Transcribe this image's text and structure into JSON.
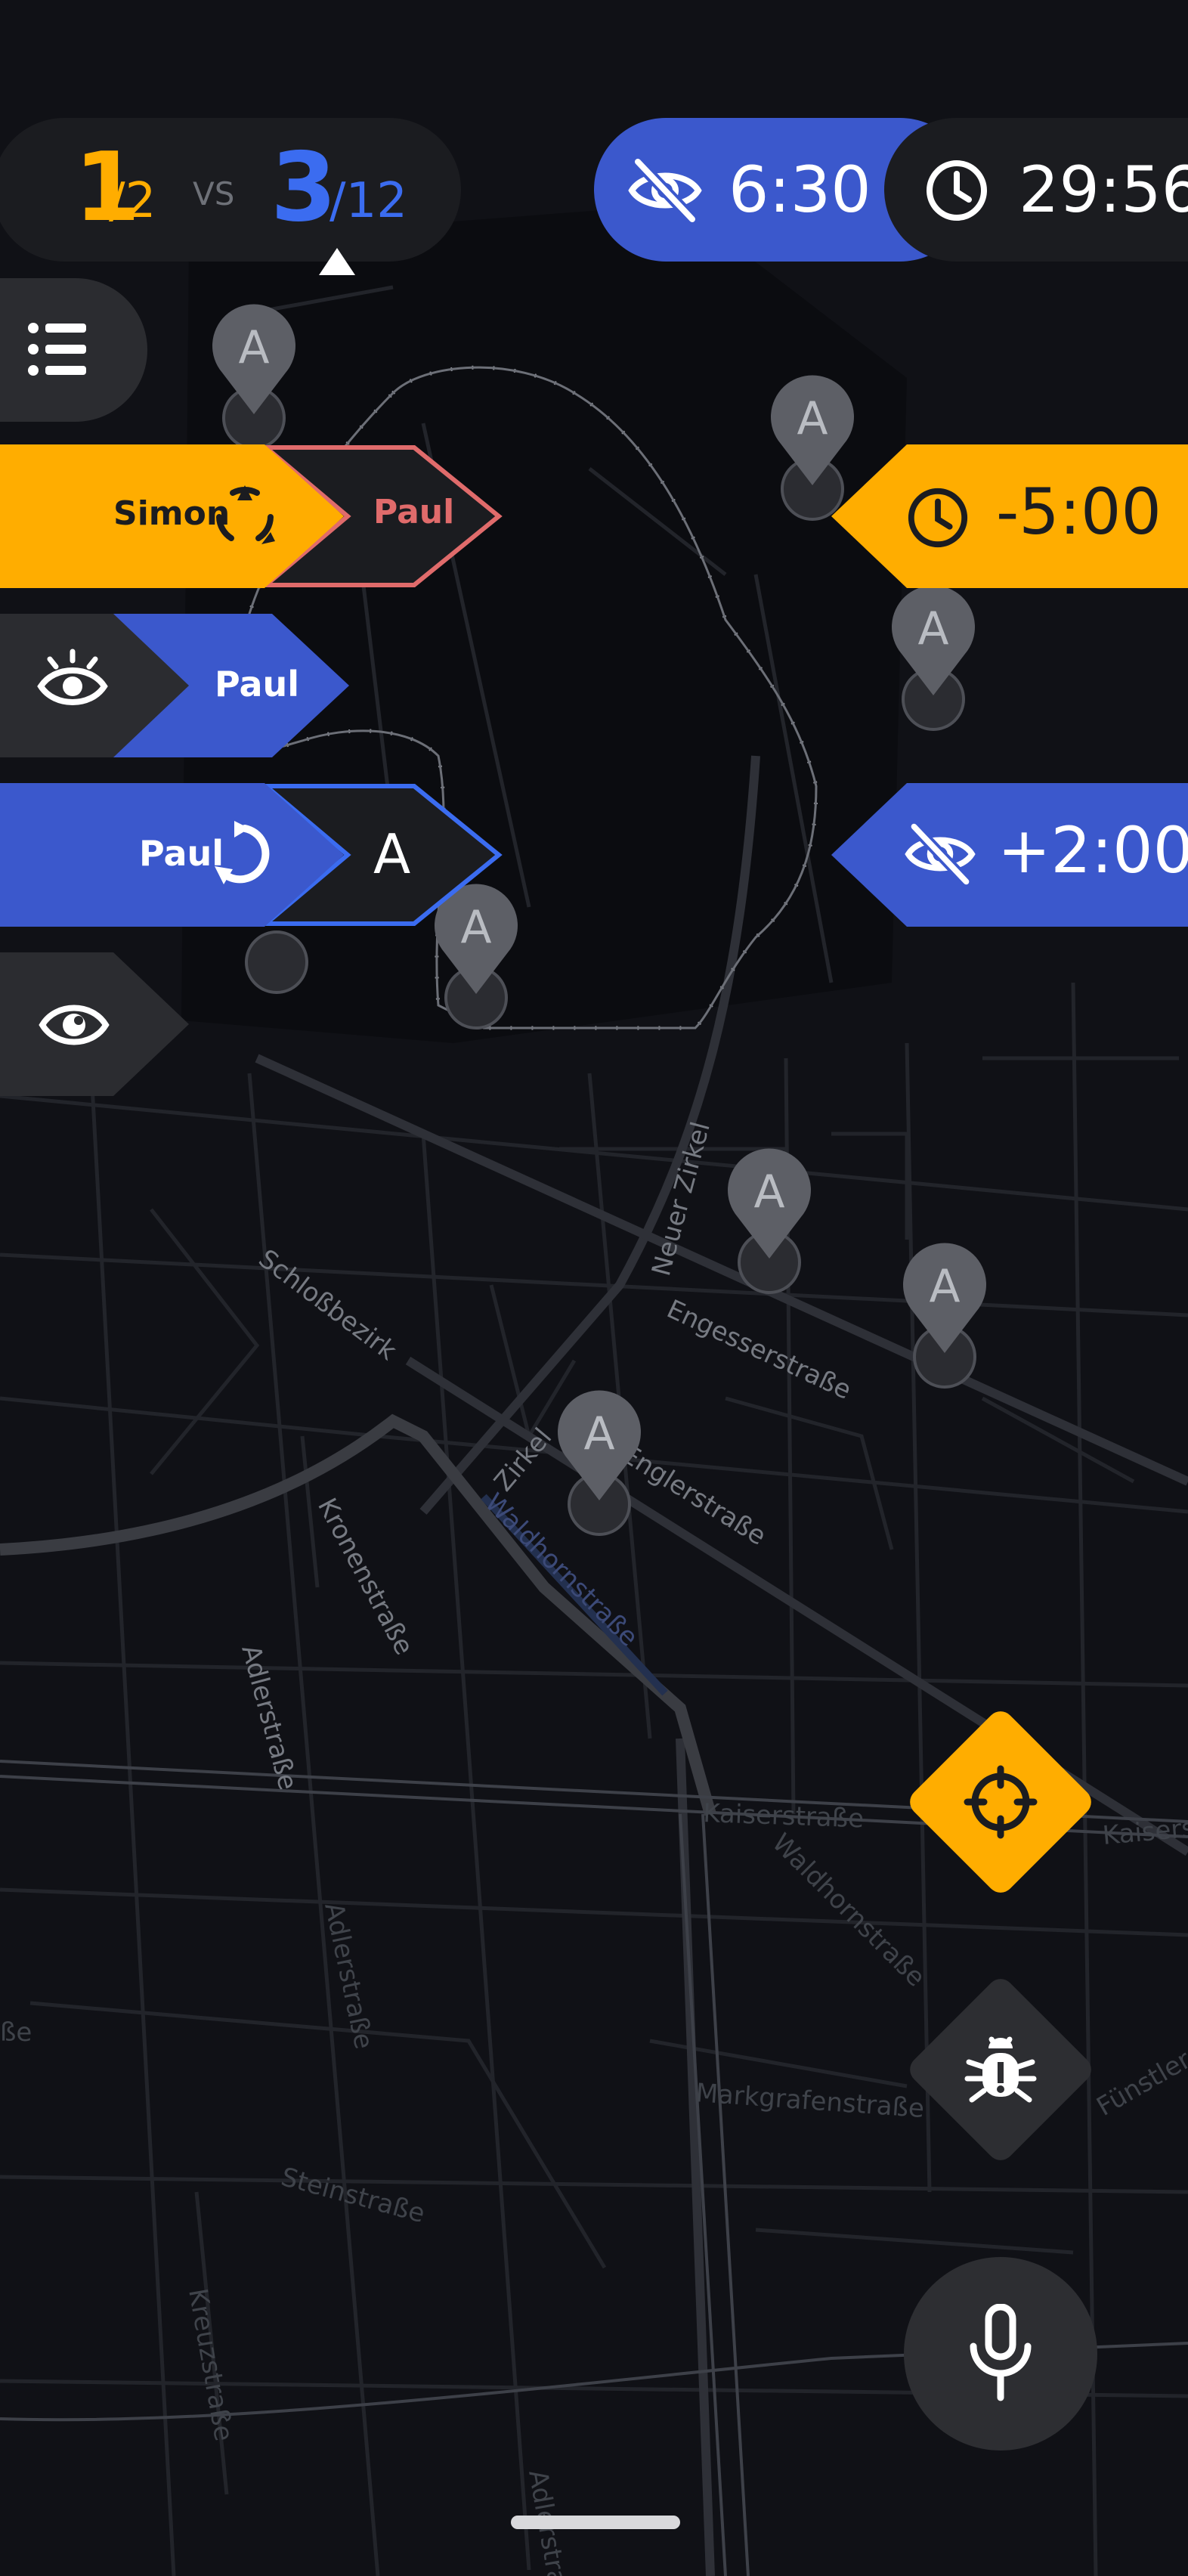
{
  "score": {
    "own_count": "1",
    "own_total": "/2",
    "vs": "VS",
    "enemy_count": "3",
    "enemy_total": "/12"
  },
  "timers": {
    "hidden_time": "6:30",
    "game_time": "29:56"
  },
  "events": {
    "catch_banner": {
      "actor": "Simon",
      "target": "Paul"
    },
    "reveal_banner": {
      "target": "Paul"
    },
    "capture_banner": {
      "actor": "Paul",
      "point": "A"
    },
    "time_penalty": "-5:00",
    "hidden_bonus": "+2:00"
  },
  "map": {
    "streets": [
      "Schloßbezirk",
      "Neuer Zirkel",
      "Engesserstraße",
      "Zirkel",
      "Englerstraße",
      "Waldhornstraße",
      "Kronenstraße",
      "Adlerstraße",
      "Adlerstraße",
      "Kaiserstraße",
      "Waldhornstraße",
      "Markgrafenstraße",
      "Steinstraße",
      "Kreuzstraße",
      "Adlerstraße",
      "straße",
      "Fünstler",
      "Kaiserstraße",
      "ße"
    ],
    "point_label": "A"
  },
  "icons": {
    "list": "list-icon",
    "eye_off": "eye-off-icon",
    "clock": "clock-icon",
    "triad": "triad-icon",
    "reveal": "reveal-eye-icon",
    "capture": "capture-arrow-icon",
    "eye": "eye-icon",
    "crosshair": "crosshair-icon",
    "bug": "bug-icon",
    "mic": "microphone-icon",
    "triangle": "turn-indicator-icon"
  },
  "colors": {
    "orange": "#ffad00",
    "blue": "#3b58cc",
    "dark": "#1b1c20",
    "pink": "#e06b6b",
    "gray": "#2b2c30"
  }
}
